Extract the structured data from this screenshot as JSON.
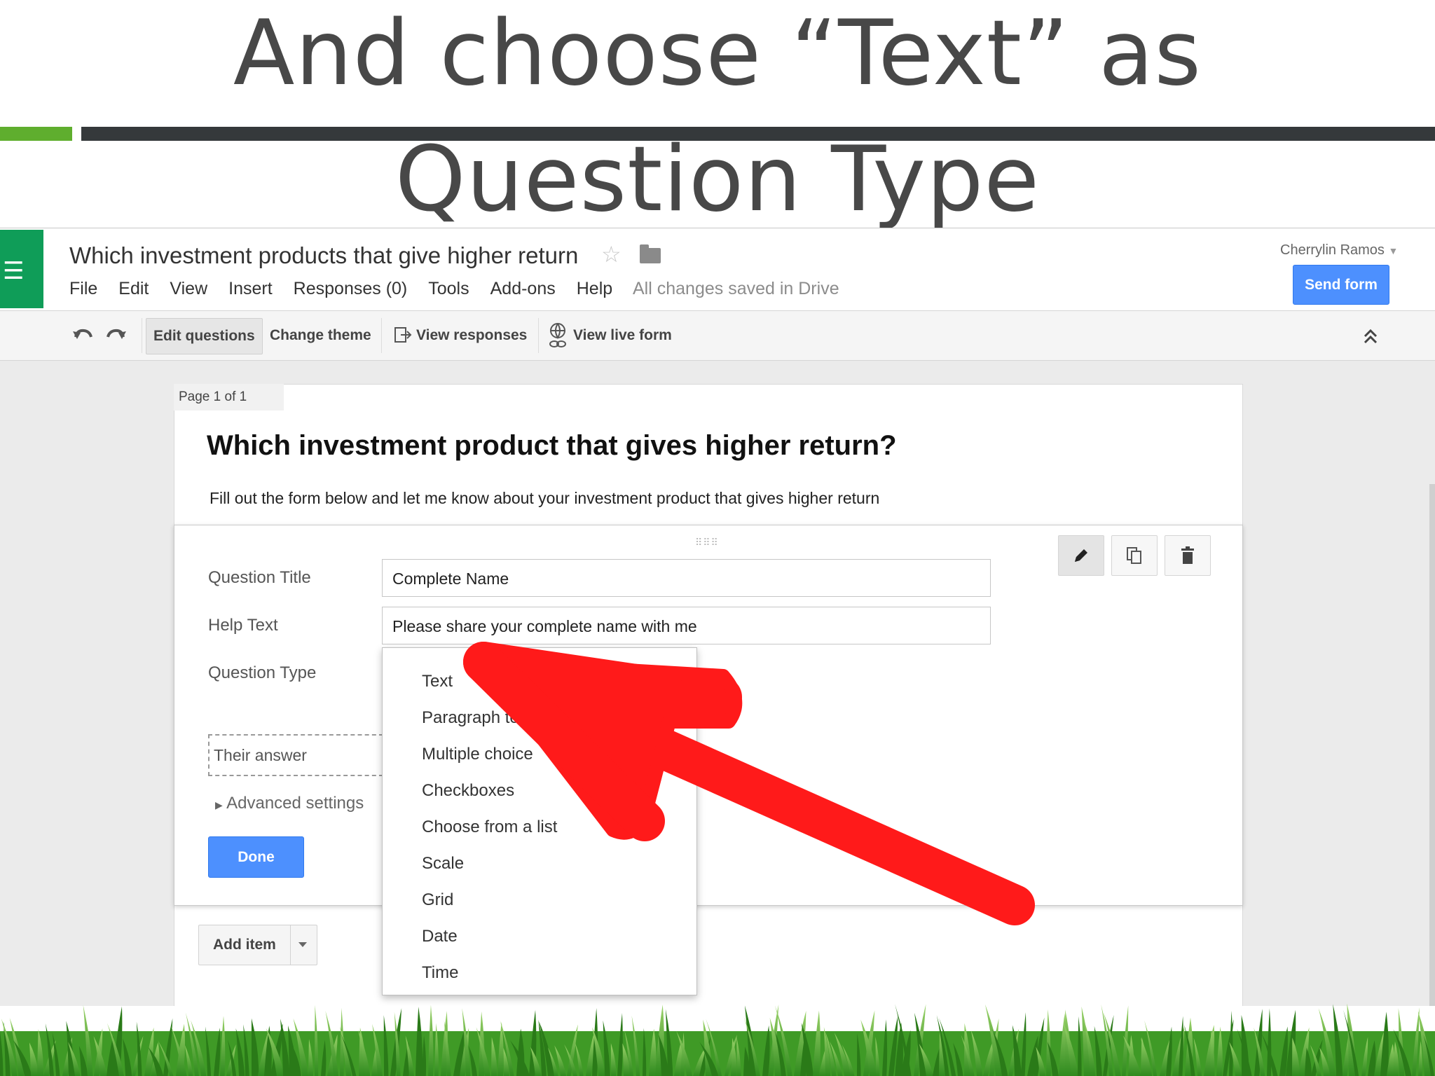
{
  "slide": {
    "title_line1": "And choose “Text” as",
    "title_line2": "Question Type"
  },
  "app": {
    "doc_title": "Which investment products that give higher return",
    "menu": [
      "File",
      "Edit",
      "View",
      "Insert",
      "Responses (0)",
      "Tools",
      "Add-ons",
      "Help"
    ],
    "save_status": "All changes saved in Drive",
    "user_name": "Cherrylin Ramos",
    "send_button": "Send form",
    "icons": {
      "app": "sheets-list-icon",
      "star": "star-icon",
      "folder": "folder-icon"
    }
  },
  "toolbar": {
    "edit_questions": "Edit questions",
    "change_theme": "Change theme",
    "view_responses": "View responses",
    "view_live_form": "View live form",
    "icons": [
      "undo-icon",
      "redo-icon",
      "responses-icon",
      "globe-link-icon",
      "collapse-icon"
    ]
  },
  "form": {
    "page_label": "Page 1 of 1",
    "title": "Which investment product that gives higher return?",
    "description": "Fill out the form below and let me know about your investment product that gives higher return",
    "question": {
      "title_label": "Question Title",
      "title_value": "Complete Name",
      "help_label": "Help Text",
      "help_value": "Please share your complete name with me",
      "type_label": "Question Type",
      "answer_placeholder": "Their answer",
      "advanced_settings": "Advanced settings",
      "done_button": "Done"
    },
    "add_item": "Add item"
  },
  "question_types": [
    "Text",
    "Paragraph text",
    "Multiple choice",
    "Checkboxes",
    "Choose from a list",
    "Scale",
    "Grid",
    "Date",
    "Time"
  ],
  "colors": {
    "accent_blue": "#4d90fe",
    "sheets_green": "#0f9d58",
    "title_gray": "#484848",
    "arrow_red": "#ff0000",
    "bar_green": "#5fae2e",
    "bar_dark": "#35393b"
  }
}
